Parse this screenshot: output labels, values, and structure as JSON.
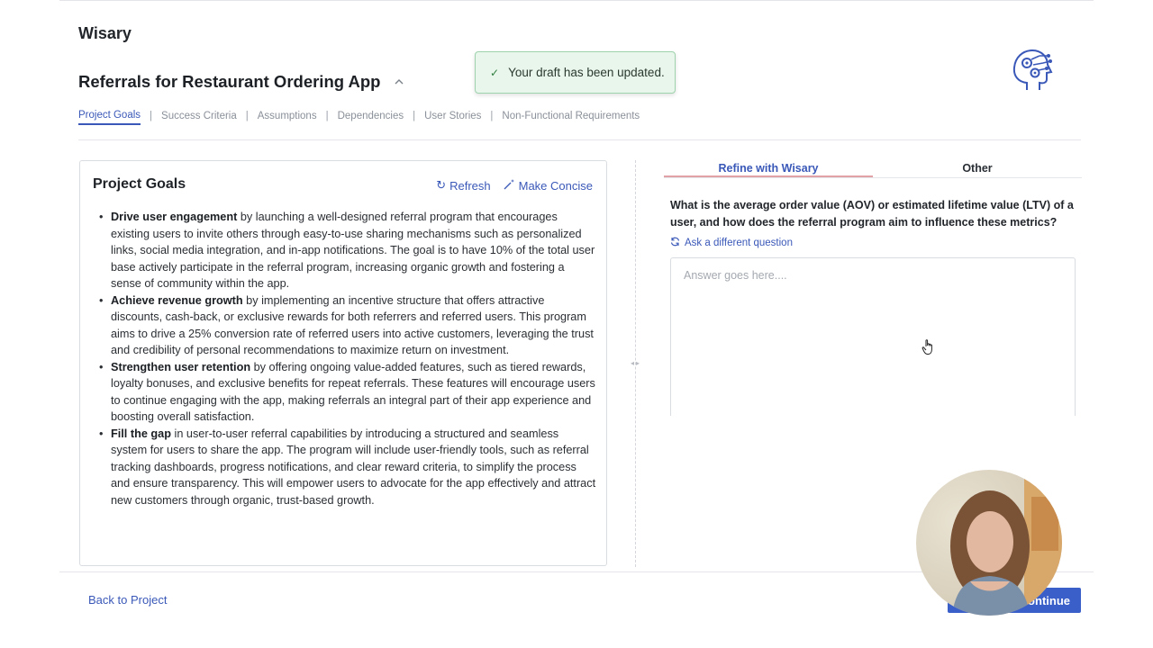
{
  "app": {
    "name": "Wisary"
  },
  "page": {
    "title": "Referrals for Restaurant Ordering App"
  },
  "toast": {
    "message": "Your draft has been updated."
  },
  "tabs": [
    {
      "label": "Project Goals",
      "active": true
    },
    {
      "label": "Success Criteria",
      "active": false
    },
    {
      "label": "Assumptions",
      "active": false
    },
    {
      "label": "Dependencies",
      "active": false
    },
    {
      "label": "User Stories",
      "active": false
    },
    {
      "label": "Non-Functional Requirements",
      "active": false
    }
  ],
  "tab_separator": "|",
  "goals": {
    "title": "Project Goals",
    "refresh_label": "Refresh",
    "concise_label": "Make Concise",
    "items": [
      {
        "bold": "Drive user engagement",
        "text": " by launching a well-designed referral program that encourages existing users to invite others through easy-to-use sharing mechanisms such as personalized links, social media integration, and in-app notifications. The goal is to have 10% of the total user base actively participate in the referral program, increasing organic growth and fostering a sense of community within the app."
      },
      {
        "bold": "Achieve revenue growth",
        "text": " by implementing an incentive structure that offers attractive discounts, cash-back, or exclusive rewards for both referrers and referred users. This program aims to drive a 25% conversion rate of referred users into active customers, leveraging the trust and credibility of personal recommendations to maximize return on investment."
      },
      {
        "bold": "Strengthen user retention",
        "text": " by offering ongoing value-added features, such as tiered rewards, loyalty bonuses, and exclusive benefits for repeat referrals. These features will encourage users to continue engaging with the app, making referrals an integral part of their app experience and boosting overall satisfaction."
      },
      {
        "bold": "Fill the gap",
        "text": " in user-to-user referral capabilities by introducing a structured and seamless system for users to share the app. The program will include user-friendly tools, such as referral tracking dashboards, progress notifications, and clear reward criteria, to simplify the process and ensure transparency. This will empower users to advocate for the app effectively and attract new customers through organic, trust-based growth."
      }
    ]
  },
  "refine": {
    "tab_active": "Refine with Wisary",
    "tab_other": "Other",
    "question": "What is the average order value (AOV) or estimated lifetime value (LTV) of a user, and how does the referral program aim to influence these metrics?",
    "ask_different": "Ask a different question",
    "answer_placeholder": "Answer goes here....",
    "answer_value": ""
  },
  "footer": {
    "back_label": "Back to Project",
    "continue_label": "Continue"
  },
  "colors": {
    "accent": "#3a58b8",
    "toast_bg": "#e9f6ec",
    "continue_bg": "#3a5fc8"
  },
  "icons": [
    "chevron-up-icon",
    "check-icon",
    "refresh-icon",
    "magic-wand-icon",
    "resize-handle-icon",
    "sync-icon",
    "brain-logo-icon",
    "hand-cursor-icon"
  ]
}
